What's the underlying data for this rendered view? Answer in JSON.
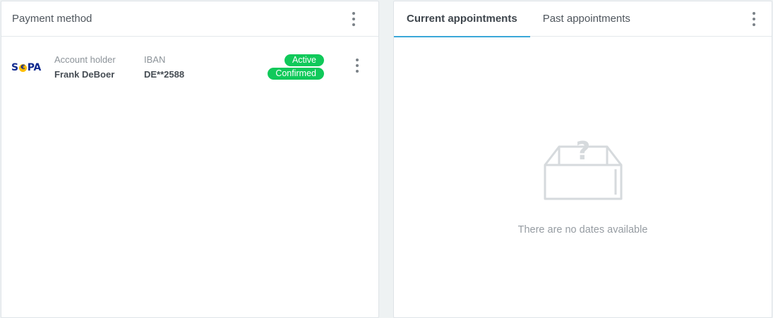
{
  "payment": {
    "title": "Payment method",
    "logo_text_left": "S",
    "logo_euro": "€",
    "logo_text_right": "PA",
    "account_holder_label": "Account holder",
    "account_holder_value": "Frank DeBoer",
    "iban_label": "IBAN",
    "iban_value": "DE**2588",
    "badge_active": "Active",
    "badge_confirmed": "Confirmed",
    "badge_color": "#10c95a",
    "icons": [
      "more-vertical-icon"
    ]
  },
  "appointments": {
    "tabs": [
      {
        "label": "Current appointments",
        "active": true
      },
      {
        "label": "Past appointments",
        "active": false
      }
    ],
    "empty_message": "There are no dates available",
    "accent_color": "#3aa8d8",
    "icons": [
      "empty-box-question-icon",
      "more-vertical-icon"
    ]
  }
}
